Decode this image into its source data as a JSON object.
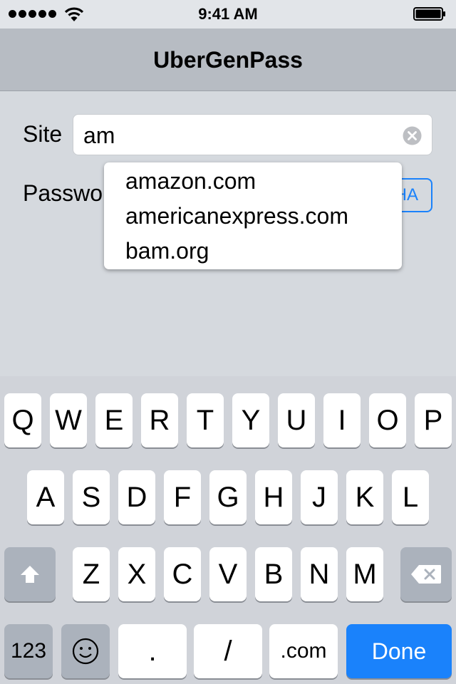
{
  "status_bar": {
    "time": "9:41 AM",
    "signal_icon": "signal-dots-icon",
    "wifi_icon": "wifi-icon",
    "battery_icon": "battery-full-icon"
  },
  "nav": {
    "title": "UberGenPass"
  },
  "form": {
    "site_label": "Site",
    "site_value": "am",
    "password_label": "Password",
    "hash_button": "SHA",
    "clear_icon": "clear-circle-icon"
  },
  "autocomplete": {
    "items": [
      "amazon.com",
      "americanexpress.com",
      "bam.org"
    ]
  },
  "keyboard": {
    "row1": [
      "Q",
      "W",
      "E",
      "R",
      "T",
      "Y",
      "U",
      "I",
      "O",
      "P"
    ],
    "row2": [
      "A",
      "S",
      "D",
      "F",
      "G",
      "H",
      "J",
      "K",
      "L"
    ],
    "row3": [
      "Z",
      "X",
      "C",
      "V",
      "B",
      "N",
      "M"
    ],
    "shift_icon": "shift-arrow-icon",
    "delete_icon": "backspace-icon",
    "numbers_label": "123",
    "emoji_icon": "emoji-face-icon",
    "period_label": ".",
    "slash_label": "/",
    "dotcom_label": ".com",
    "done_label": "Done"
  },
  "colors": {
    "accent": "#1a82fb",
    "nav_bg": "#b7bcc3",
    "keyboard_bg": "#d0d3d9"
  }
}
